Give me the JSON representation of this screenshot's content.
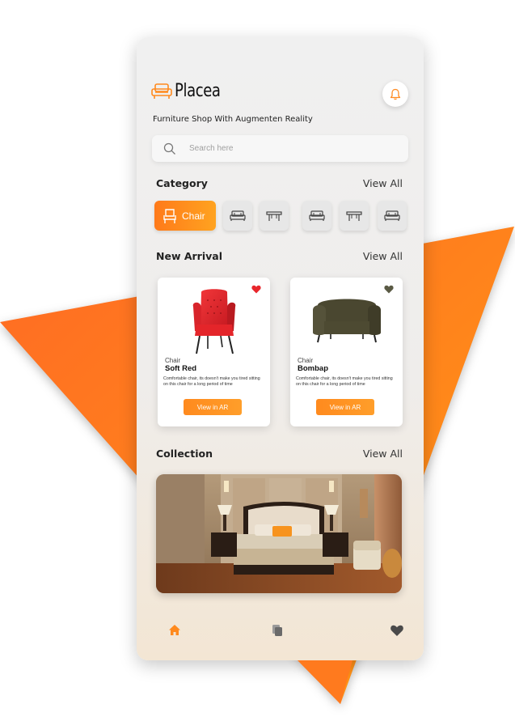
{
  "app": {
    "name": "Placea",
    "tagline": "Furniture Shop With Augmenten Reality"
  },
  "search": {
    "placeholder": "Search here",
    "value": ""
  },
  "category": {
    "title": "Category",
    "view_all": "View All",
    "chips": [
      {
        "label": "Chair",
        "icon": "chair-icon",
        "active": true
      },
      {
        "label": "",
        "icon": "bed-icon",
        "active": false
      },
      {
        "label": "",
        "icon": "table-icon",
        "active": false
      },
      {
        "label": "",
        "icon": "bed-icon",
        "active": false
      },
      {
        "label": "",
        "icon": "table-icon",
        "active": false
      },
      {
        "label": "",
        "icon": "bed-icon",
        "active": false
      }
    ]
  },
  "new_arrival": {
    "title": "New Arrival",
    "view_all": "View All",
    "products": [
      {
        "category": "Chair",
        "name": "Soft Red",
        "description": "Comfortable chair, its doesn't make you tired sitting on this chair for a long period of time",
        "cta": "View in AR",
        "favorite_color": "#e8262c",
        "product_color": "#e4252a"
      },
      {
        "category": "Chair",
        "name": "Bombap",
        "description": "Comfortable chair, its doesn't make you tired sitting on this chair for a long period of time",
        "cta": "View in AR",
        "favorite_color": "#5a5a44",
        "product_color": "#4d4a32"
      }
    ]
  },
  "collection": {
    "title": "Collection",
    "view_all": "View All",
    "image": "bedroom-photo"
  },
  "bottom_nav": [
    {
      "icon": "home-icon",
      "active": true
    },
    {
      "icon": "copy-icon",
      "active": false
    },
    {
      "icon": "heart-icon",
      "active": false
    }
  ],
  "colors": {
    "accent": "#ff8a1e",
    "accent_light": "#ffa320",
    "background_shape": "#ff7a1e"
  }
}
